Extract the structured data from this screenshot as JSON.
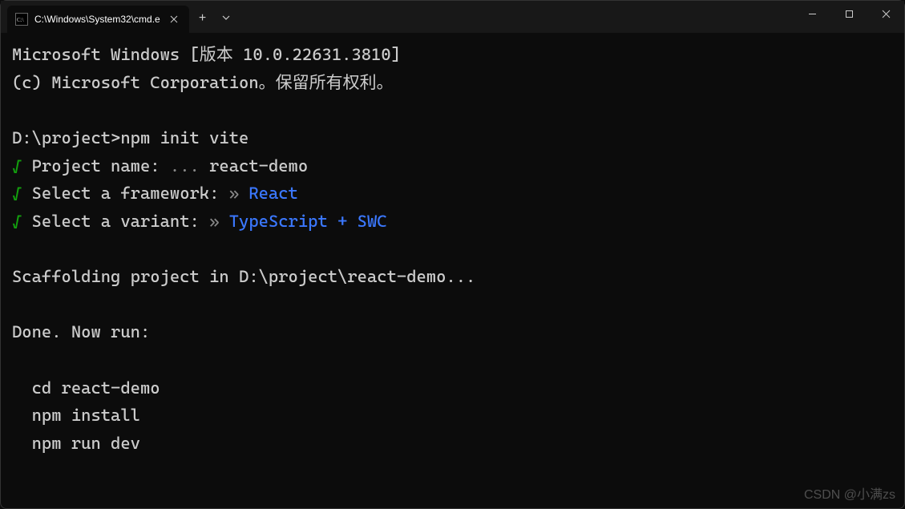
{
  "titlebar": {
    "tab_title": "C:\\Windows\\System32\\cmd.e",
    "tab_icon_label": "cmd"
  },
  "terminal": {
    "line1": "Microsoft Windows [版本 10.0.22631.3810]",
    "line2": "(c) Microsoft Corporation。保留所有权利。",
    "prompt_line": "D:\\project>npm init vite",
    "check_glyph": "√",
    "proj_name_label": " Project name:",
    "proj_name_sep": " ... ",
    "proj_name_value": "react-demo",
    "framework_label": " Select a framework:",
    "arrow_sep": " » ",
    "framework_value": "React",
    "variant_label": " Select a variant:",
    "variant_value": "TypeScript + SWC",
    "scaffold_line": "Scaffolding project in D:\\project\\react-demo...",
    "done_line": "Done. Now run:",
    "cmd1": "  cd react-demo",
    "cmd2": "  npm install",
    "cmd3": "  npm run dev"
  },
  "watermark": "CSDN @小满zs"
}
